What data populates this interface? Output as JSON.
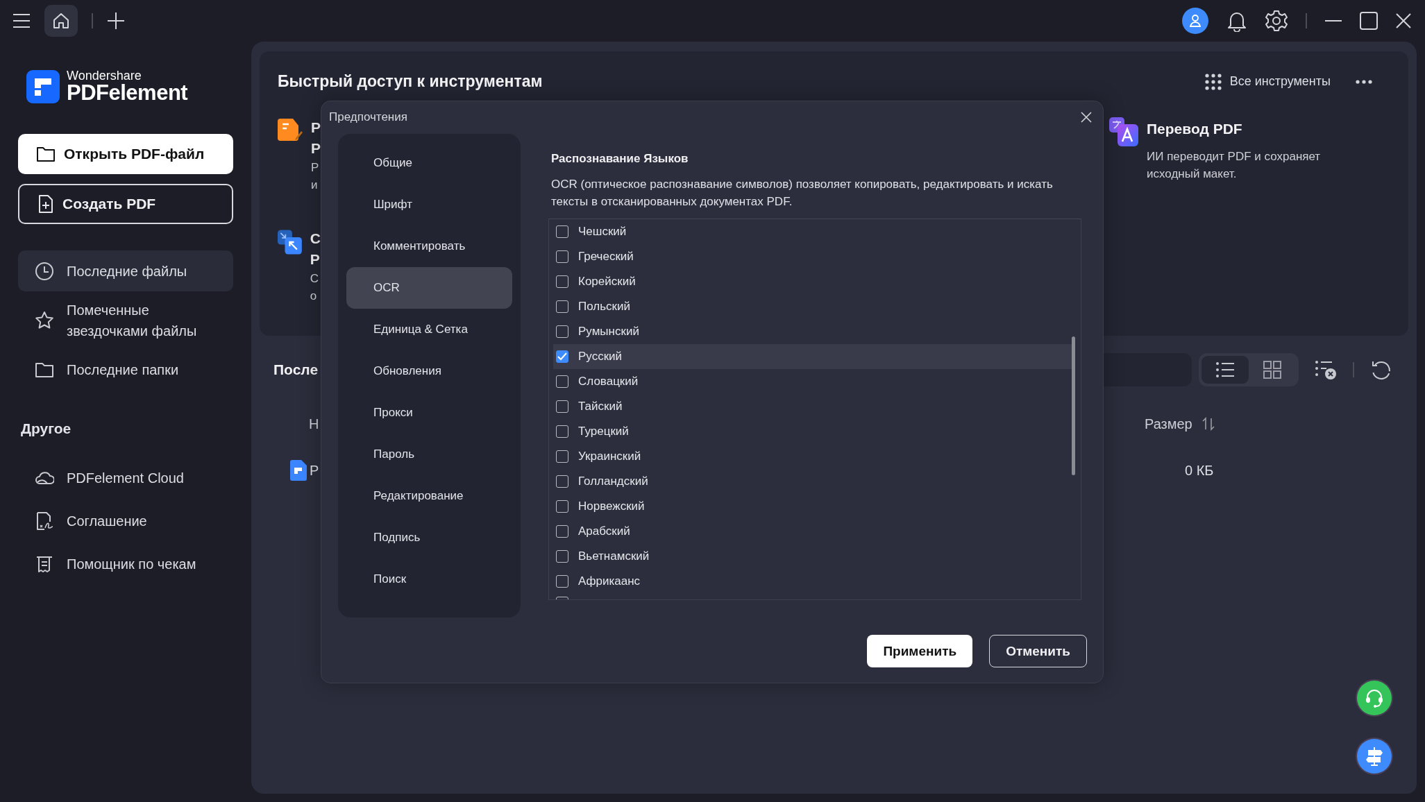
{
  "sidebar": {
    "logo": {
      "brand": "Wondershare",
      "product": "PDFelement"
    },
    "actions": [
      {
        "label": "Открыть PDF-файл",
        "kind": "primary"
      },
      {
        "label": "Создать PDF",
        "kind": "outline"
      }
    ],
    "items": [
      {
        "label": "Последние файлы",
        "selected": true
      },
      {
        "label": "Помеченные звездочками файлы",
        "selected": false
      },
      {
        "label": "Последние папки",
        "selected": false
      }
    ],
    "section_title": "Другое",
    "other_items": [
      {
        "label": "PDFelement Cloud"
      },
      {
        "label": "Соглашение"
      },
      {
        "label": "Помощник по чекам"
      }
    ]
  },
  "quick_access": {
    "title": "Быстрый доступ к инструментам",
    "all_tools": "Все инструменты",
    "tools": [
      {
        "kind": "edit",
        "title_lines": [
          "Р",
          "Р"
        ],
        "description_lines": [
          "Р",
          "и"
        ]
      },
      {
        "kind": "compress",
        "title_lines": [
          "С",
          "Р"
        ],
        "description_lines": [
          "С",
          "о"
        ]
      },
      {
        "kind": "translate",
        "title_lines": [
          "Перевод PDF"
        ],
        "description_lines": [
          "ИИ переводит PDF и сохраняет",
          "исходный макет."
        ]
      }
    ]
  },
  "recent": {
    "title": "После",
    "view_modes": [
      {
        "kind": "list",
        "selected": true
      },
      {
        "kind": "grid",
        "selected": false
      }
    ],
    "columns": [
      "Н",
      "Размер"
    ],
    "rows": [
      {
        "name": "Р",
        "size": "0 КБ"
      }
    ]
  },
  "dialog": {
    "title": "Предпочтения",
    "nav": [
      {
        "label": "Общие",
        "selected": false
      },
      {
        "label": "Шрифт",
        "selected": false
      },
      {
        "label": "Комментировать",
        "selected": false
      },
      {
        "label": "OCR",
        "selected": true
      },
      {
        "label": "Единица & Сетка",
        "selected": false
      },
      {
        "label": "Обновления",
        "selected": false
      },
      {
        "label": "Прокси",
        "selected": false
      },
      {
        "label": "Пароль",
        "selected": false
      },
      {
        "label": "Редактирование",
        "selected": false
      },
      {
        "label": "Подпись",
        "selected": false
      },
      {
        "label": "Поиск",
        "selected": false
      }
    ],
    "heading": "Распознавание Языков",
    "description": "OCR (оптическое распознавание символов) позволяет копировать, редактировать и искать тексты в отсканированных документах PDF.",
    "languages": [
      {
        "label": "Чешский",
        "checked": false,
        "selected": false
      },
      {
        "label": "Греческий",
        "checked": false,
        "selected": false
      },
      {
        "label": "Корейский",
        "checked": false,
        "selected": false
      },
      {
        "label": "Польский",
        "checked": false,
        "selected": false
      },
      {
        "label": "Румынский",
        "checked": false,
        "selected": false
      },
      {
        "label": "Русский",
        "checked": true,
        "selected": true
      },
      {
        "label": "Словацкий",
        "checked": false,
        "selected": false
      },
      {
        "label": "Тайский",
        "checked": false,
        "selected": false
      },
      {
        "label": "Турецкий",
        "checked": false,
        "selected": false
      },
      {
        "label": "Украинский",
        "checked": false,
        "selected": false
      },
      {
        "label": "Голландский",
        "checked": false,
        "selected": false
      },
      {
        "label": "Норвежский",
        "checked": false,
        "selected": false
      },
      {
        "label": "Арабский",
        "checked": false,
        "selected": false
      },
      {
        "label": "Вьетнамский",
        "checked": false,
        "selected": false
      },
      {
        "label": "Африкаанс",
        "checked": false,
        "selected": false
      }
    ],
    "buttons": [
      {
        "label": "Применить",
        "kind": "primary"
      },
      {
        "label": "Отменить",
        "kind": "outline"
      }
    ]
  }
}
